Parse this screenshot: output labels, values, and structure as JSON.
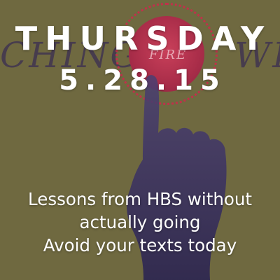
{
  "background": {
    "color": "#6f6940",
    "text_left": "CHING",
    "text_right": "WH",
    "button_label": "FIRE",
    "button_color": "#b0324d",
    "ring_color": "#c0314a",
    "hand_color": "#3d3566"
  },
  "headline": {
    "day": "THURSDAY",
    "date": "5.28.15"
  },
  "topics": [
    "Lessons from HBS without",
    "actually going",
    "Avoid your texts today"
  ]
}
